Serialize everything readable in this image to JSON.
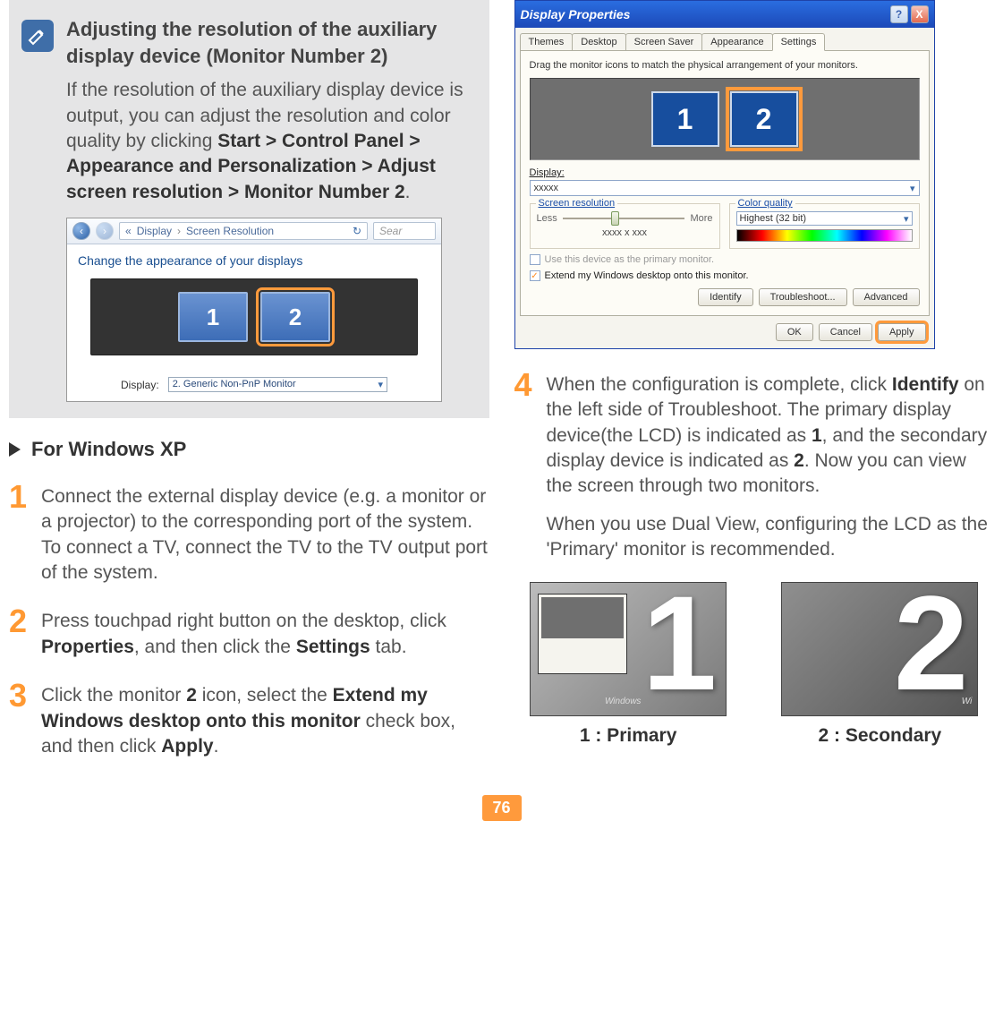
{
  "note": {
    "title": "Adjusting the resolution of the auxiliary display device (Monitor Number 2)",
    "body_pre": "If the resolution of the auxiliary display device is output, you can adjust the resolution and color quality by clicking ",
    "body_bold": "Start > Control Panel > Appearance and Personalization > Adjust screen resolution > Monitor Number 2",
    "body_post": "."
  },
  "vistaShot": {
    "crumb1": "Display",
    "crumb2": "Screen Resolution",
    "searchPlaceholder": "Sear",
    "heading": "Change the appearance of your displays",
    "mon1": "1",
    "mon2": "2",
    "dispLabel": "Display:",
    "dispValue": "2. Generic Non-PnP Monitor"
  },
  "section": {
    "title": "For Windows XP"
  },
  "steps": {
    "s1": {
      "num": "1",
      "text": "Connect the external display device (e.g. a monitor or a projector) to the corresponding port of the system. To connect a TV, connect the TV to the TV output port of the system."
    },
    "s2": {
      "num": "2",
      "pre": "Press touchpad right button on the desktop, click ",
      "b1": "Properties",
      "mid": ", and then click the ",
      "b2": "Settings",
      "post": " tab."
    },
    "s3": {
      "num": "3",
      "pre": "Click the monitor ",
      "b1": "2",
      "mid1": " icon, select the ",
      "b2": "Extend my Windows desktop onto this monitor",
      "mid2": " check box, and then click ",
      "b3": "Apply",
      "post": "."
    },
    "s4": {
      "num": "4",
      "p1_pre": "When the configuration is complete, click ",
      "p1_b1": "Identify",
      "p1_mid1": " on the left side of Troubleshoot. The primary display device(the LCD) is indicated as ",
      "p1_b2": "1",
      "p1_mid2": ", and the secondary display device is indicated as ",
      "p1_b3": "2",
      "p1_post": ". Now you can view the screen through two monitors.",
      "p2": "When you use Dual View, configuring the LCD as the 'Primary' monitor is recommended."
    }
  },
  "xp": {
    "title": "Display Properties",
    "tabs": [
      "Themes",
      "Desktop",
      "Screen Saver",
      "Appearance",
      "Settings"
    ],
    "activeTab": "Settings",
    "instr": "Drag the monitor icons to match the physical arrangement of your monitors.",
    "mon1": "1",
    "mon2": "2",
    "dispLabel": "Display:",
    "dispValue": "xxxxx",
    "res": {
      "title": "Screen resolution",
      "less": "Less",
      "more": "More",
      "value": "xxxx  x  xxx"
    },
    "cq": {
      "title": "Color quality",
      "value": "Highest (32 bit)"
    },
    "chk1": "Use this device as the primary monitor.",
    "chk2": "Extend my Windows desktop onto this monitor.",
    "btn_identify": "Identify",
    "btn_troubleshoot": "Troubleshoot...",
    "btn_advanced": "Advanced",
    "btn_ok": "OK",
    "btn_cancel": "Cancel",
    "btn_apply": "Apply"
  },
  "identify": {
    "n1": "1",
    "n2": "2",
    "cap1": "1 : Primary",
    "cap2": "2 : Secondary",
    "winLabel": "Windows"
  },
  "pageNumber": "76"
}
